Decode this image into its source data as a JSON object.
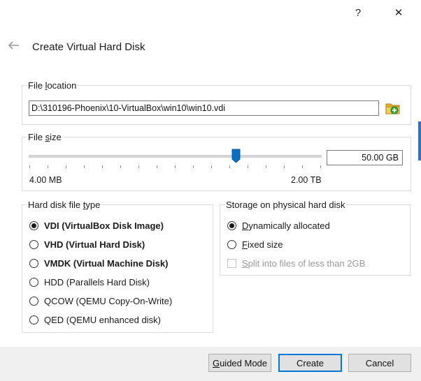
{
  "titlebar": {
    "help_label": "?",
    "close_label": "✕"
  },
  "dialog": {
    "title": "Create Virtual Hard Disk",
    "back_icon": "arrow-left-icon"
  },
  "file_location": {
    "label_pre": "File ",
    "label_u": "l",
    "label_post": "ocation",
    "path": "D:\\310196-Phoenix\\10-VirtualBox\\win10\\win10.vdi",
    "browse_icon": "folder-browse-icon"
  },
  "file_size": {
    "label_pre": "File ",
    "label_u": "s",
    "label_post": "ize",
    "value": "50.00 GB",
    "min_label": "4.00 MB",
    "max_label": "2.00 TB",
    "slider_fraction": 0.71
  },
  "disk_type": {
    "label_pre": "Hard disk file ",
    "label_u": "t",
    "label_post": "ype",
    "options": [
      {
        "label": "VDI (VirtualBox Disk Image)",
        "checked": true,
        "bold": true
      },
      {
        "label": "VHD (Virtual Hard Disk)",
        "checked": false,
        "bold": true
      },
      {
        "label": "VMDK (Virtual Machine Disk)",
        "checked": false,
        "bold": true
      },
      {
        "label": "HDD (Parallels Hard Disk)",
        "checked": false,
        "bold": false
      },
      {
        "label": "QCOW (QEMU Copy-On-Write)",
        "checked": false,
        "bold": false
      },
      {
        "label": "QED (QEMU enhanced disk)",
        "checked": false,
        "bold": false
      }
    ]
  },
  "storage": {
    "label": "Storage on physical hard disk",
    "dynamic_pre": "",
    "dynamic_u": "D",
    "dynamic_post": "ynamically allocated",
    "fixed_pre": "",
    "fixed_u": "F",
    "fixed_post": "ixed size",
    "split_pre": "",
    "split_u": "S",
    "split_post": "plit into files of less than 2GB",
    "dynamic_checked": true
  },
  "buttons": {
    "guided_pre": "",
    "guided_u": "G",
    "guided_post": "uided Mode",
    "create": "Create",
    "cancel": "Cancel"
  }
}
